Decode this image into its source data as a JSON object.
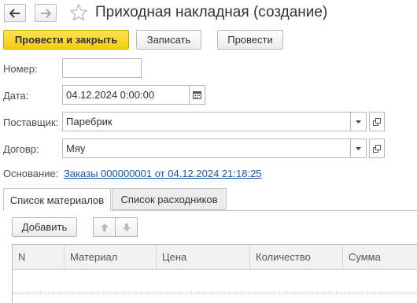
{
  "header": {
    "title": "Приходная накладная (создание)",
    "back_icon": "arrow-left-icon",
    "forward_icon": "arrow-right-icon",
    "favorite_icon": "star-icon"
  },
  "toolbar": {
    "post_close_label": "Провести и закрыть",
    "write_label": "Записать",
    "post_label": "Провести",
    "accent": "#f8d21e"
  },
  "form": {
    "number": {
      "label": "Номер:",
      "value": ""
    },
    "date": {
      "label": "Дата:",
      "value": "04.12.2024  0:00:00"
    },
    "supplier": {
      "label": "Поставщик:",
      "value": "Паребрик"
    },
    "contract": {
      "label": "Договр:",
      "value": "Мяу"
    },
    "basis": {
      "label": "Основание:",
      "value": "Заказы 000000001 от 04.12.2024 21:18:25"
    }
  },
  "tabs": [
    {
      "label": "Список материалов",
      "active": true
    },
    {
      "label": "Список расходников",
      "active": false
    }
  ],
  "table": {
    "add_label": "Добавить",
    "columns": [
      "N",
      "Материал",
      "Цена",
      "Количество",
      "Сумма"
    ]
  },
  "colors": {
    "link": "#1a55a3",
    "border": "#b7b7b7"
  }
}
